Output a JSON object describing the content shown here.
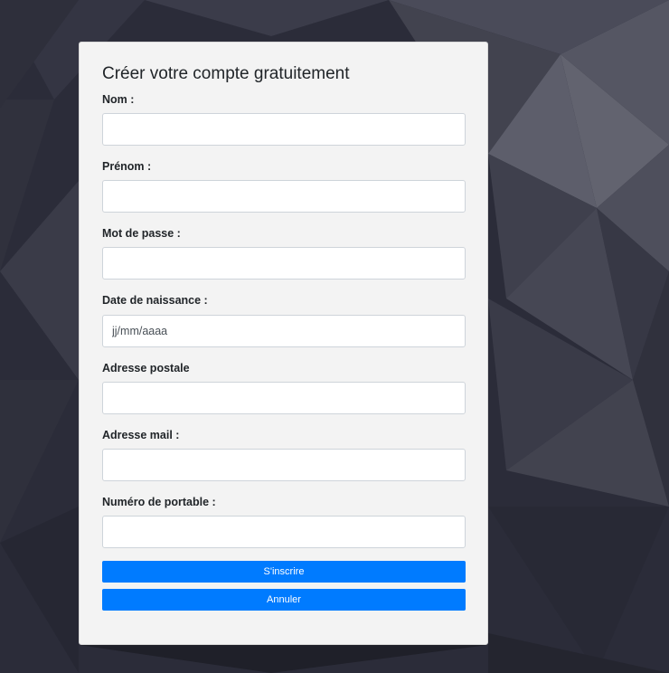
{
  "theme": {
    "background": "#2a2b38",
    "card_background": "#f3f3f3",
    "accent": "#007bff"
  },
  "form": {
    "title": "Créer votre compte gratuitement",
    "fields": [
      {
        "label": "Nom :",
        "value": "",
        "placeholder": "",
        "type": "text"
      },
      {
        "label": "Prénom :",
        "value": "",
        "placeholder": "",
        "type": "text"
      },
      {
        "label": "Mot de passe :",
        "value": "",
        "placeholder": "",
        "type": "password"
      },
      {
        "label": "Date de naissance :",
        "value": "",
        "placeholder": "jj/mm/aaaa",
        "type": "text"
      },
      {
        "label": "Adresse postale",
        "value": "",
        "placeholder": "",
        "type": "text"
      },
      {
        "label": "Adresse mail :",
        "value": "",
        "placeholder": "",
        "type": "email"
      },
      {
        "label": "Numéro de portable :",
        "value": "",
        "placeholder": "",
        "type": "tel"
      }
    ],
    "submit_label": "S'inscrire",
    "cancel_label": "Annuler"
  }
}
